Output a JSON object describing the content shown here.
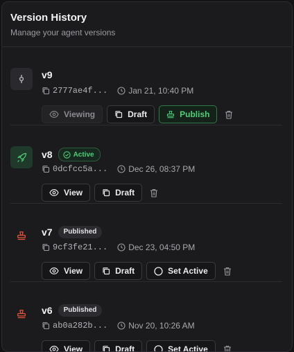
{
  "header": {
    "title": "Version History",
    "subtitle": "Manage your agent versions"
  },
  "versions": [
    {
      "name": "v9",
      "hash": "2777ae4f...",
      "time": "Jan 21, 10:40 PM",
      "icon": "commit-icon",
      "actions": {
        "viewing": "Viewing",
        "draft": "Draft",
        "publish": "Publish"
      }
    },
    {
      "name": "v8",
      "badge": "Active",
      "hash": "0dcfcc5a...",
      "time": "Dec 26, 08:37 PM",
      "icon": "rocket-icon",
      "actions": {
        "view": "View",
        "draft": "Draft"
      }
    },
    {
      "name": "v7",
      "badge": "Published",
      "hash": "9cf3fe21...",
      "time": "Dec 23, 04:50 PM",
      "icon": "stamp-icon",
      "actions": {
        "view": "View",
        "draft": "Draft",
        "set_active": "Set Active"
      }
    },
    {
      "name": "v6",
      "badge": "Published",
      "hash": "ab0a282b...",
      "time": "Nov 20, 10:26 AM",
      "icon": "stamp-icon",
      "actions": {
        "view": "View",
        "draft": "Draft",
        "set_active": "Set Active"
      }
    }
  ],
  "colors": {
    "background": "#1b1b1d",
    "active_green": "#4ccf78",
    "stamp_red": "#e5533d"
  }
}
